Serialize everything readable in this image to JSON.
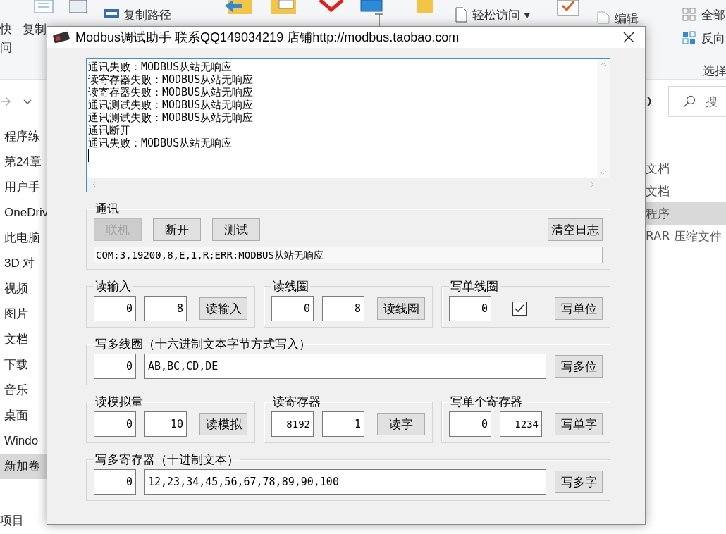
{
  "background": {
    "ribbon": [
      {
        "kind": "text",
        "label": "快"
      },
      {
        "kind": "text",
        "label": "问"
      },
      {
        "kind": "text",
        "label": "复制"
      },
      {
        "kind": "text",
        "label": "复制路径"
      },
      {
        "kind": "menu",
        "label": "轻松访问",
        "caret": "▾"
      },
      {
        "kind": "text",
        "label": "编辑"
      },
      {
        "kind": "text",
        "label": "全部"
      },
      {
        "kind": "text",
        "label": "反向"
      },
      {
        "kind": "text",
        "label": "选择"
      }
    ],
    "search": {
      "placeholder": "搜"
    },
    "nav": [
      {
        "label": "程序练",
        "selected": false
      },
      {
        "label": "第24章",
        "selected": false
      },
      {
        "label": "用户手",
        "selected": false
      },
      {
        "label": "OneDriv",
        "selected": false
      },
      {
        "label": "此电脑",
        "selected": false
      },
      {
        "label": "3D 对",
        "selected": false
      },
      {
        "label": "视频",
        "selected": false
      },
      {
        "label": "图片",
        "selected": false
      },
      {
        "label": "文档",
        "selected": false
      },
      {
        "label": "下载",
        "selected": false
      },
      {
        "label": "音乐",
        "selected": false
      },
      {
        "label": "桌面",
        "selected": false
      },
      {
        "label": "Windo",
        "selected": false
      },
      {
        "label": "新加卷",
        "selected": true
      }
    ],
    "files": [
      {
        "label": "文档",
        "selected": false
      },
      {
        "label": "文档",
        "selected": false
      },
      {
        "label": "程序",
        "selected": true
      },
      {
        "label": "RAR 压缩文件",
        "selected": false
      }
    ],
    "status": [
      "项目"
    ]
  },
  "window": {
    "title": "Modbus调试助手 联系QQ149034219 店铺http://modbus.taobao.com"
  },
  "log": {
    "lines": [
      "通讯失败：MODBUS从站无响应",
      "读寄存器失败：MODBUS从站无响应",
      "读寄存器失败：MODBUS从站无响应",
      "通讯测试失败：MODBUS从站无响应",
      "通讯测试失败：MODBUS从站无响应",
      "通讯断开",
      "通讯失败：MODBUS从站无响应"
    ]
  },
  "comm": {
    "title": "通讯",
    "buttons": [
      {
        "label": "联机",
        "disabled": true
      },
      {
        "label": "断开",
        "disabled": false
      },
      {
        "label": "测试",
        "disabled": false
      }
    ],
    "clear_button": "清空日志",
    "status": "COM:3,19200,8,E,1,R;ERR:MODBUS从站无响应"
  },
  "rows": [
    {
      "groups": [
        {
          "title": "读输入",
          "fields": [
            {
              "kind": "number",
              "value": "0"
            },
            {
              "kind": "number",
              "value": "8"
            }
          ],
          "button": "读输入"
        },
        {
          "title": "读线圈",
          "fields": [
            {
              "kind": "number",
              "value": "0"
            },
            {
              "kind": "number",
              "value": "8"
            }
          ],
          "button": "读线圈"
        },
        {
          "title": "写单线圈",
          "fields": [
            {
              "kind": "number",
              "value": "0"
            },
            {
              "kind": "checkbox",
              "checked": true
            }
          ],
          "button": "写单位"
        }
      ]
    },
    {
      "groups": [
        {
          "title": "写多线圈（十六进制文本字节方式写入）",
          "fields": [
            {
              "kind": "number",
              "value": "0"
            },
            {
              "kind": "text",
              "value": "AB,BC,CD,DE"
            }
          ],
          "button": "写多位"
        }
      ]
    },
    {
      "groups": [
        {
          "title": "读模拟量",
          "fields": [
            {
              "kind": "number",
              "value": "0"
            },
            {
              "kind": "number",
              "value": "10"
            }
          ],
          "button": "读模拟"
        },
        {
          "title": "读寄存器",
          "fields": [
            {
              "kind": "number",
              "value": "8192"
            },
            {
              "kind": "number",
              "value": "1"
            }
          ],
          "button": "读字"
        },
        {
          "title": "写单个寄存器",
          "fields": [
            {
              "kind": "number",
              "value": "0"
            },
            {
              "kind": "number",
              "value": "1234"
            }
          ],
          "button": "写单字"
        }
      ]
    },
    {
      "groups": [
        {
          "title": "写多寄存器（十进制文本）",
          "fields": [
            {
              "kind": "number",
              "value": "0"
            },
            {
              "kind": "text",
              "value": "12,23,34,45,56,67,78,89,90,100"
            }
          ],
          "button": "写多字"
        }
      ]
    }
  ]
}
